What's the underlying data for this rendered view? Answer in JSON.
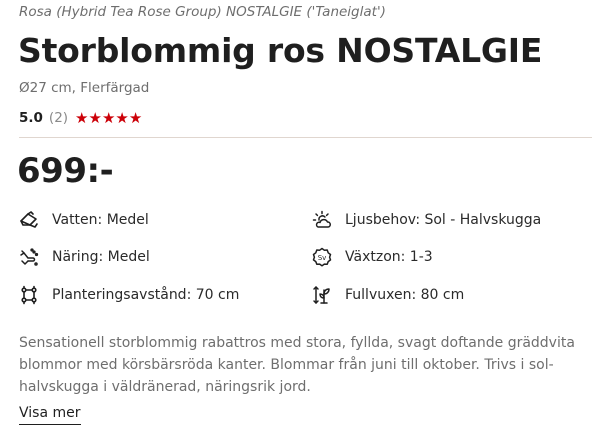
{
  "product": {
    "latin_name": "Rosa (Hybrid Tea Rose Group) NOSTALGIE ('Taneiglat')",
    "title": "Storblommig ros NOSTALGIE",
    "spec": "Ø27 cm, Flerfärgad",
    "rating": {
      "score": "5.0",
      "count": "(2)",
      "stars": "★★★★★",
      "stars_value": 5,
      "star_color": "#cc0008"
    },
    "price": "699:-"
  },
  "attributes": {
    "water": {
      "label": "Vatten: Medel",
      "icon": "water-can-icon"
    },
    "light": {
      "label": "Ljusbehov: Sol - Halvskugga",
      "icon": "sun-cloud-icon"
    },
    "nutrition": {
      "label": "Näring: Medel",
      "icon": "fertilizer-hand-icon"
    },
    "zone": {
      "label": "Växtzon: 1-3",
      "icon": "zone-badge-icon"
    },
    "spacing": {
      "label": "Planteringsavstånd: 70 cm",
      "icon": "plant-spacing-icon"
    },
    "height": {
      "label": "Fullvuxen: 80 cm",
      "icon": "plant-height-icon"
    }
  },
  "description": {
    "text": "Sensationell storblommig rabattros med stora, fyllda, svagt doftande gräddvita blommor med körsbärsröda kanter. Blommar från juni till oktober. Trivs i sol-halvskugga i väldränerad, näringsrik jord.",
    "more_label": "Visa mer"
  }
}
